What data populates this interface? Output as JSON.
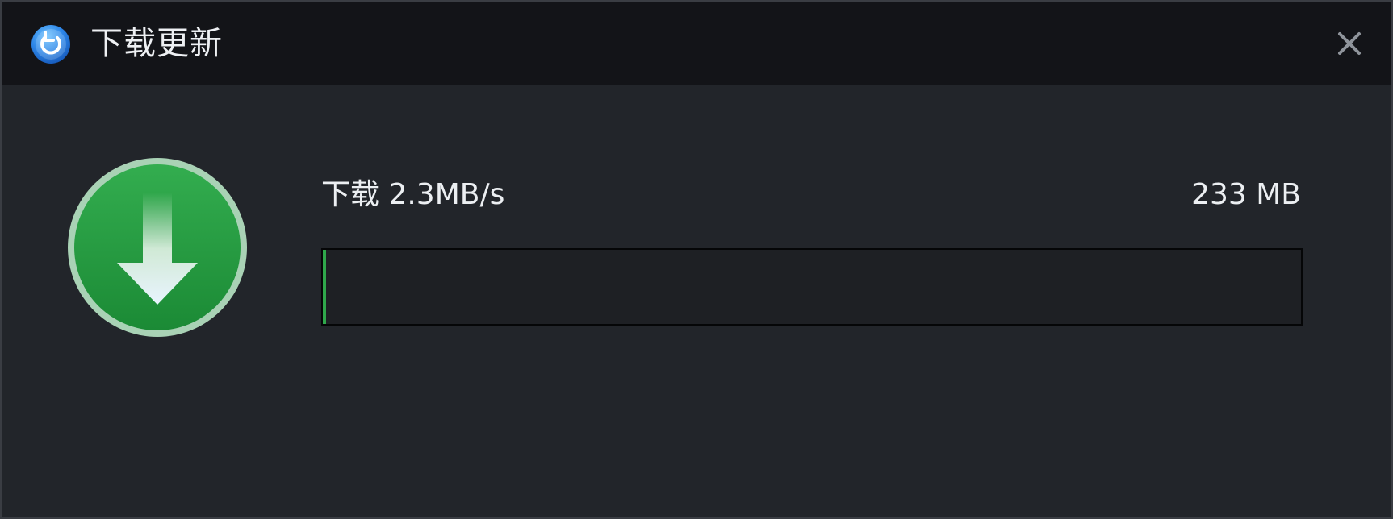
{
  "window": {
    "title": "下载更新",
    "app_icon": "refresh-circle-icon",
    "close_icon": "close-icon"
  },
  "download": {
    "speed_label": "下载 2.3MB/s",
    "total_size": "233 MB",
    "progress_fraction": 0.003,
    "icon": "download-arrow-icon"
  },
  "colors": {
    "titlebar": "#131418",
    "background": "#22252a",
    "progress_fill": "#2fa84b",
    "badge_green": "#28a046"
  }
}
